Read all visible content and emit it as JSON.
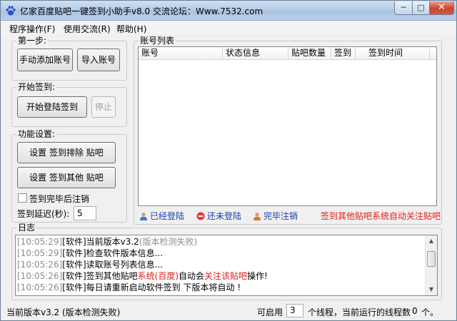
{
  "window": {
    "title": "亿家百度贴吧一键签到小助手v8.0 交流论坛：Www.7532.com",
    "minimize": "─",
    "maximize": "□",
    "close": "✕"
  },
  "menu": [
    "程序操作(F)",
    "使用交流(R)",
    "帮助(H)"
  ],
  "step1": {
    "label": "第一步:",
    "add_manual": "手动添加账号",
    "import": "导入账号"
  },
  "start": {
    "label": "开始签到:",
    "start_button": "开始登陆签到",
    "stop_button": "停止"
  },
  "settings": {
    "label": "功能设置:",
    "exclude_button": "设置 签到排除 贴吧",
    "other_button": "设置 签到其他 贴吧",
    "logout_checkbox": "签到完毕后注销",
    "logout_checked": false,
    "delay_label": "签到延迟(秒):",
    "delay_value": "5"
  },
  "accounts": {
    "label": "账号列表",
    "columns": [
      "账号",
      "状态信息",
      "贴吧数量",
      "签到",
      "签到时间"
    ]
  },
  "legend": {
    "logged_in": "已经登陆",
    "not_logged": "还未登陆",
    "done_logout": "完毕注销",
    "notice": "签到其他贴吧系统自动关注贴吧"
  },
  "log": {
    "label": "日志",
    "lines": [
      {
        "time": "[10:05:29]",
        "pre": "[软件]当前版本v3.2",
        "red": "",
        "mid": "",
        "red2": "",
        "post": "",
        "gray": "(版本检测失败)"
      },
      {
        "time": "[10:05:29]",
        "pre": "[软件]检查软件版本信息...",
        "red": "",
        "mid": "",
        "red2": "",
        "post": "",
        "gray": ""
      },
      {
        "time": "[10:05:26]",
        "pre": "[软件]读取账号列表信息...",
        "red": "",
        "mid": "",
        "red2": "",
        "post": "",
        "gray": ""
      },
      {
        "time": "[10:05:26]",
        "pre": "[软件]签到其他贴吧",
        "red": "系统(百度)",
        "mid": "自动会",
        "red2": "关注该贴吧",
        "post": "操作!",
        "gray": ""
      },
      {
        "time": "[10:05:26]",
        "pre": "[软件]每日请重新启动软件签到 下版本将自动 !",
        "red": "",
        "mid": "",
        "red2": "",
        "post": "",
        "gray": ""
      }
    ]
  },
  "status": {
    "version": "当前版本v3.2 (版本检测失败)",
    "threads_label": "可启用",
    "threads_value": "3",
    "threads_suffix": "个线程，当前运行的线程数",
    "running": "0",
    "running_suffix": "个。"
  },
  "icons": {
    "app": "baidu-paw-icon",
    "logged_in": "user-blue-icon",
    "not_logged": "stop-red-icon",
    "done_logout": "user-orange-icon"
  }
}
